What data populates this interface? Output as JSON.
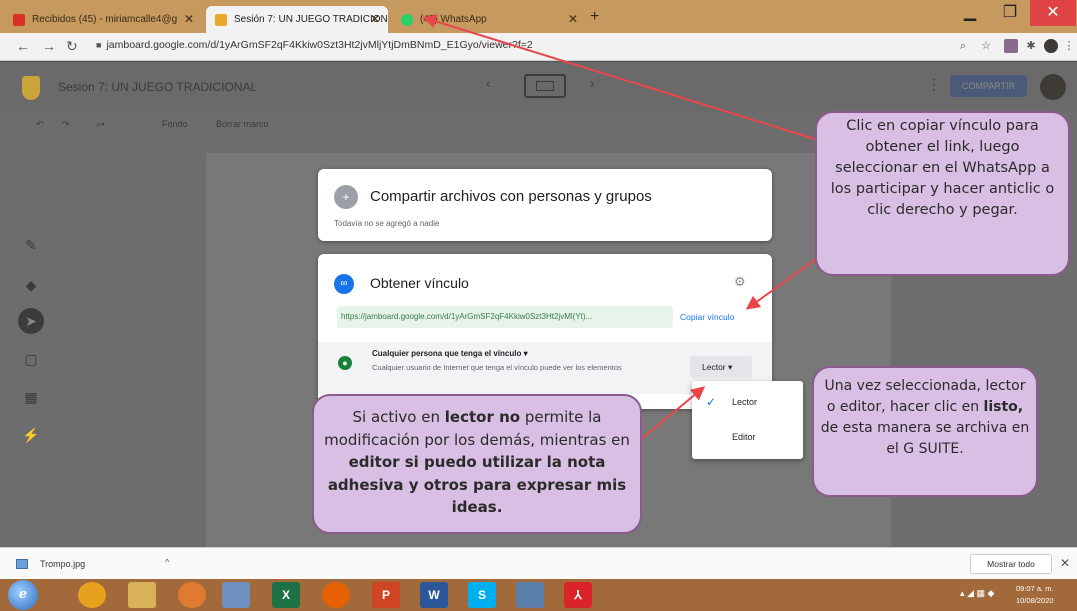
{
  "browser": {
    "tabs": [
      {
        "title": "Recibidos (45) - miriamcalle4@g"
      },
      {
        "title": "Sesión 7: UN JUEGO TRADICION"
      },
      {
        "title": "(45) WhatsApp"
      }
    ],
    "new_tab": "+",
    "url": "jamboard.google.com/d/1yArGmSF2qF4Kkiw0Szt3Ht2jvMljYtjDmBNmD_E1Gyo/viewer?f=2"
  },
  "app": {
    "title": "Sesión 7: UN JUEGO TRADICIONAL",
    "share_button": "COMPARTIR",
    "toolbar": {
      "background": "Fondo",
      "clear_frame": "Borrar marco"
    }
  },
  "share_dialog": {
    "title": "Compartir archivos con personas y grupos",
    "subtitle": "Todavía no se agregó a nadie"
  },
  "link_dialog": {
    "title": "Obtener vínculo",
    "url": "https://jamboard.google.com/d/1yArGmSF2qF4Kkiw0Szt3Ht2jvMl(Yt)...",
    "copy_label": "Copiar vínculo",
    "access_label": "Cualquier persona que tenga el vínculo",
    "access_desc": "Cualquier usuario de Internet que tenga el vínculo puede ver los elementos",
    "role": "Lector"
  },
  "role_menu": {
    "options": [
      "Lector",
      "Editor"
    ]
  },
  "annotations": {
    "bubble1": "Clic en copiar vínculo para obtener el link, luego seleccionar en el WhatsApp a los participar y hacer anticlic o clic derecho y pegar.",
    "bubble2": {
      "p1": "Si activo en ",
      "b1": "lector no",
      "p2": " permite la modificación por los demás, mientras en ",
      "b2": "editor si puedo utilizar la nota adhesiva y otros para expresar mis ideas."
    },
    "bubble3": {
      "p1": "Una vez seleccionada, lector o editor, hacer clic en ",
      "b1": "listo,",
      "p2": " de esta manera se archiva en el G SUITE."
    }
  },
  "downloads": {
    "file": "Trompo.jpg",
    "show_all": "Mostrar todo"
  },
  "taskbar": {
    "time": "09:07 a. m.",
    "date": "10/08/2020"
  },
  "colors": {
    "bubble_fill": "#d9bfe3",
    "bubble_border": "#8b5a8e",
    "arrow": "#e8464a",
    "link_blue": "#1a73e8"
  }
}
